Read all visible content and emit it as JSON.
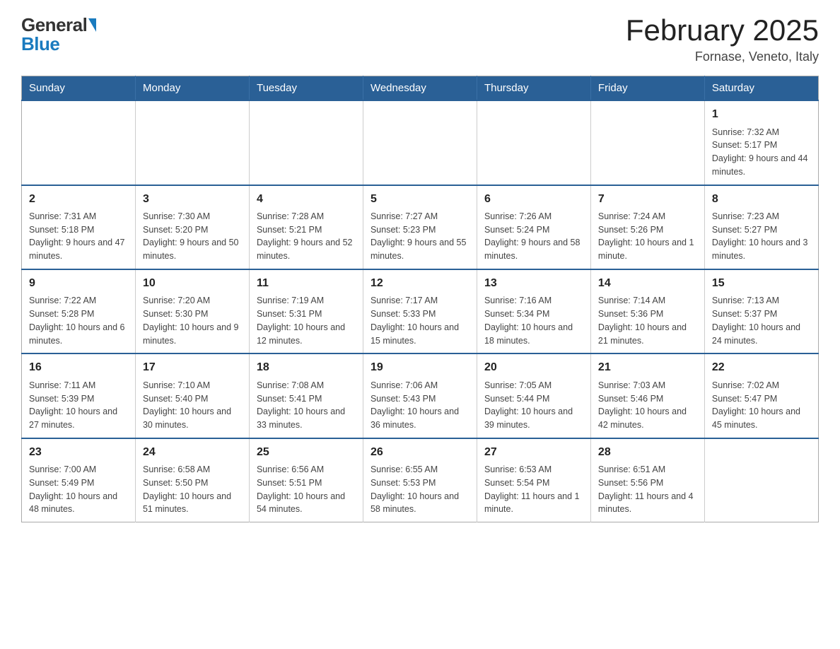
{
  "header": {
    "logo_general": "General",
    "logo_blue": "Blue",
    "title": "February 2025",
    "location": "Fornase, Veneto, Italy"
  },
  "days_of_week": [
    "Sunday",
    "Monday",
    "Tuesday",
    "Wednesday",
    "Thursday",
    "Friday",
    "Saturday"
  ],
  "weeks": [
    [
      {
        "day": "",
        "info": ""
      },
      {
        "day": "",
        "info": ""
      },
      {
        "day": "",
        "info": ""
      },
      {
        "day": "",
        "info": ""
      },
      {
        "day": "",
        "info": ""
      },
      {
        "day": "",
        "info": ""
      },
      {
        "day": "1",
        "info": "Sunrise: 7:32 AM\nSunset: 5:17 PM\nDaylight: 9 hours and 44 minutes."
      }
    ],
    [
      {
        "day": "2",
        "info": "Sunrise: 7:31 AM\nSunset: 5:18 PM\nDaylight: 9 hours and 47 minutes."
      },
      {
        "day": "3",
        "info": "Sunrise: 7:30 AM\nSunset: 5:20 PM\nDaylight: 9 hours and 50 minutes."
      },
      {
        "day": "4",
        "info": "Sunrise: 7:28 AM\nSunset: 5:21 PM\nDaylight: 9 hours and 52 minutes."
      },
      {
        "day": "5",
        "info": "Sunrise: 7:27 AM\nSunset: 5:23 PM\nDaylight: 9 hours and 55 minutes."
      },
      {
        "day": "6",
        "info": "Sunrise: 7:26 AM\nSunset: 5:24 PM\nDaylight: 9 hours and 58 minutes."
      },
      {
        "day": "7",
        "info": "Sunrise: 7:24 AM\nSunset: 5:26 PM\nDaylight: 10 hours and 1 minute."
      },
      {
        "day": "8",
        "info": "Sunrise: 7:23 AM\nSunset: 5:27 PM\nDaylight: 10 hours and 3 minutes."
      }
    ],
    [
      {
        "day": "9",
        "info": "Sunrise: 7:22 AM\nSunset: 5:28 PM\nDaylight: 10 hours and 6 minutes."
      },
      {
        "day": "10",
        "info": "Sunrise: 7:20 AM\nSunset: 5:30 PM\nDaylight: 10 hours and 9 minutes."
      },
      {
        "day": "11",
        "info": "Sunrise: 7:19 AM\nSunset: 5:31 PM\nDaylight: 10 hours and 12 minutes."
      },
      {
        "day": "12",
        "info": "Sunrise: 7:17 AM\nSunset: 5:33 PM\nDaylight: 10 hours and 15 minutes."
      },
      {
        "day": "13",
        "info": "Sunrise: 7:16 AM\nSunset: 5:34 PM\nDaylight: 10 hours and 18 minutes."
      },
      {
        "day": "14",
        "info": "Sunrise: 7:14 AM\nSunset: 5:36 PM\nDaylight: 10 hours and 21 minutes."
      },
      {
        "day": "15",
        "info": "Sunrise: 7:13 AM\nSunset: 5:37 PM\nDaylight: 10 hours and 24 minutes."
      }
    ],
    [
      {
        "day": "16",
        "info": "Sunrise: 7:11 AM\nSunset: 5:39 PM\nDaylight: 10 hours and 27 minutes."
      },
      {
        "day": "17",
        "info": "Sunrise: 7:10 AM\nSunset: 5:40 PM\nDaylight: 10 hours and 30 minutes."
      },
      {
        "day": "18",
        "info": "Sunrise: 7:08 AM\nSunset: 5:41 PM\nDaylight: 10 hours and 33 minutes."
      },
      {
        "day": "19",
        "info": "Sunrise: 7:06 AM\nSunset: 5:43 PM\nDaylight: 10 hours and 36 minutes."
      },
      {
        "day": "20",
        "info": "Sunrise: 7:05 AM\nSunset: 5:44 PM\nDaylight: 10 hours and 39 minutes."
      },
      {
        "day": "21",
        "info": "Sunrise: 7:03 AM\nSunset: 5:46 PM\nDaylight: 10 hours and 42 minutes."
      },
      {
        "day": "22",
        "info": "Sunrise: 7:02 AM\nSunset: 5:47 PM\nDaylight: 10 hours and 45 minutes."
      }
    ],
    [
      {
        "day": "23",
        "info": "Sunrise: 7:00 AM\nSunset: 5:49 PM\nDaylight: 10 hours and 48 minutes."
      },
      {
        "day": "24",
        "info": "Sunrise: 6:58 AM\nSunset: 5:50 PM\nDaylight: 10 hours and 51 minutes."
      },
      {
        "day": "25",
        "info": "Sunrise: 6:56 AM\nSunset: 5:51 PM\nDaylight: 10 hours and 54 minutes."
      },
      {
        "day": "26",
        "info": "Sunrise: 6:55 AM\nSunset: 5:53 PM\nDaylight: 10 hours and 58 minutes."
      },
      {
        "day": "27",
        "info": "Sunrise: 6:53 AM\nSunset: 5:54 PM\nDaylight: 11 hours and 1 minute."
      },
      {
        "day": "28",
        "info": "Sunrise: 6:51 AM\nSunset: 5:56 PM\nDaylight: 11 hours and 4 minutes."
      },
      {
        "day": "",
        "info": ""
      }
    ]
  ]
}
